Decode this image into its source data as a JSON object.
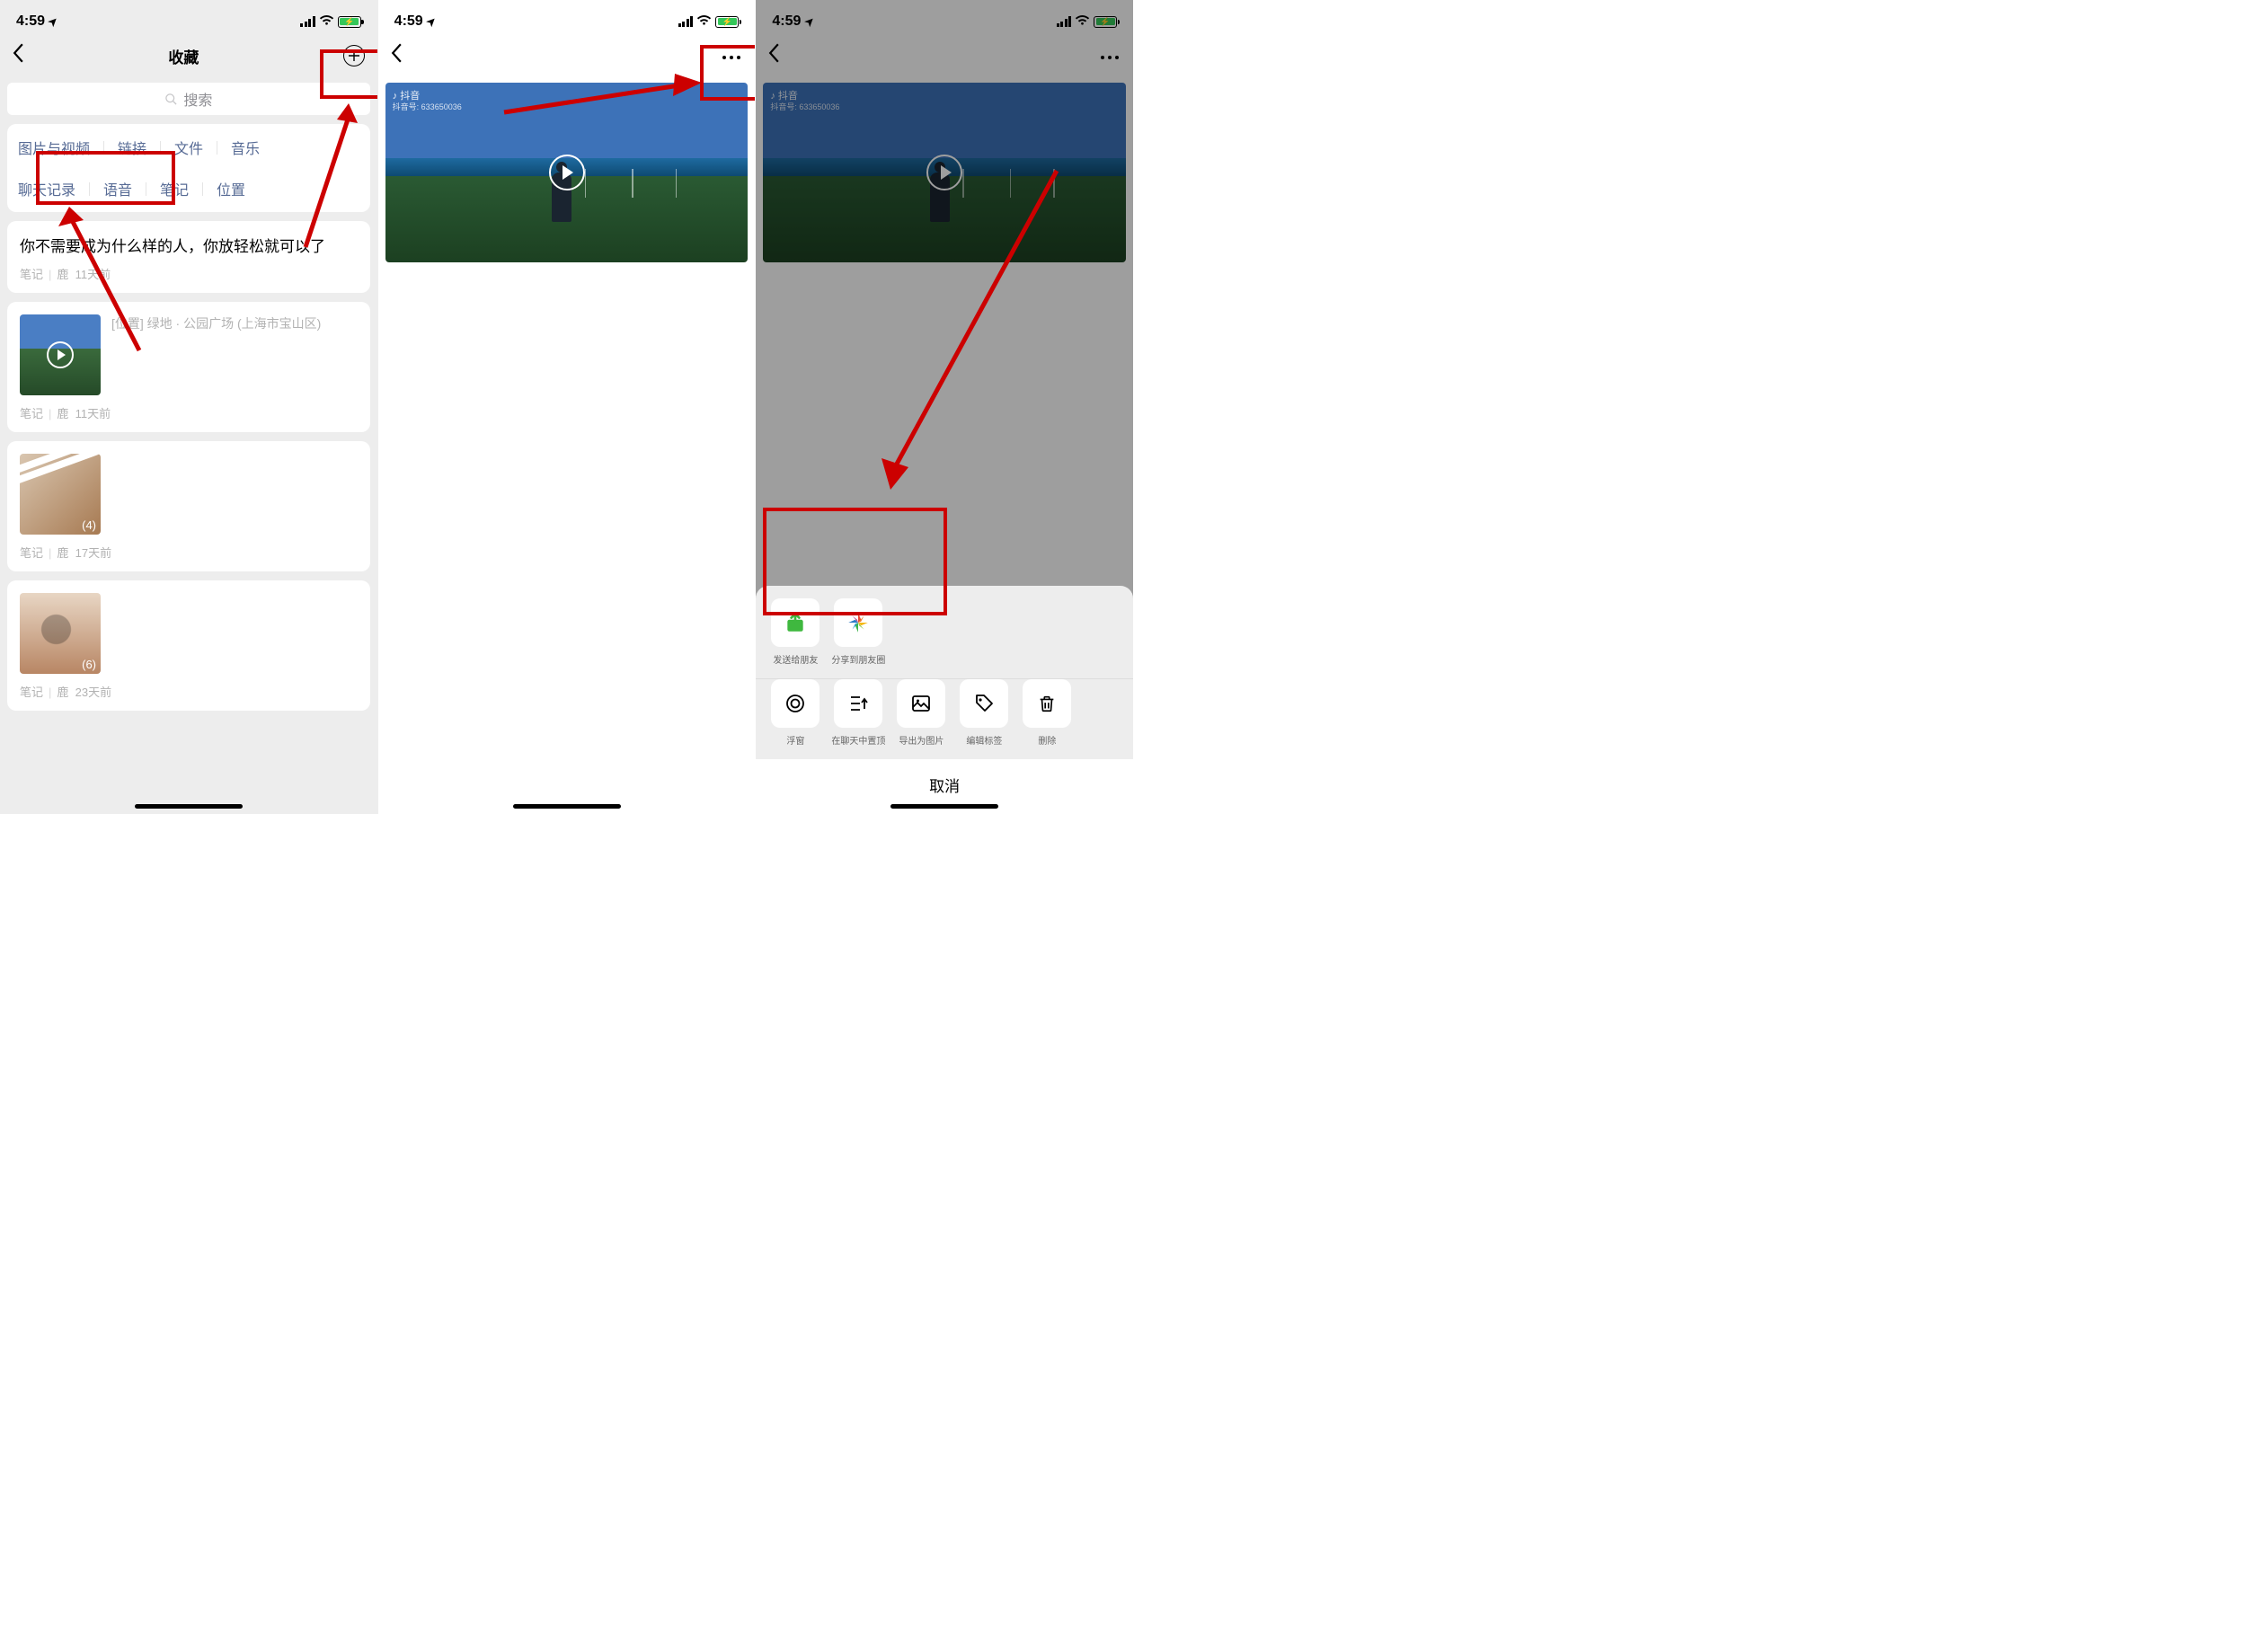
{
  "status": {
    "time": "4:59",
    "loc_arrow": "➤"
  },
  "screen1": {
    "title": "收藏",
    "search_placeholder": "搜索",
    "filters_row1": [
      "图片与视频",
      "链接",
      "文件",
      "音乐"
    ],
    "filters_row2": [
      "聊天记录",
      "语音",
      "笔记",
      "位置"
    ],
    "cards": [
      {
        "title": "你不需要成为什么样的人，你放轻松就可以了",
        "kind": "笔记",
        "author": "鹿",
        "age": "11天前"
      },
      {
        "location": "[位置] 绿地 · 公园广场 (上海市宝山区)",
        "kind": "笔记",
        "author": "鹿",
        "age": "11天前"
      },
      {
        "count": "(4)",
        "kind": "笔记",
        "author": "鹿",
        "age": "17天前"
      },
      {
        "count": "(6)",
        "kind": "笔记",
        "author": "鹿",
        "age": "23天前"
      }
    ]
  },
  "screen2": {
    "watermark_app": "抖音",
    "watermark_id": "抖音号: 633650036"
  },
  "screen3": {
    "share_row": [
      {
        "label": "发送给朋友",
        "color": "#3fb83f"
      },
      {
        "label": "分享到朋友圈"
      }
    ],
    "action_row": [
      {
        "label": "浮窗"
      },
      {
        "label": "在聊天中置顶"
      },
      {
        "label": "导出为图片"
      },
      {
        "label": "编辑标签"
      },
      {
        "label": "删除"
      }
    ],
    "cancel": "取消"
  }
}
